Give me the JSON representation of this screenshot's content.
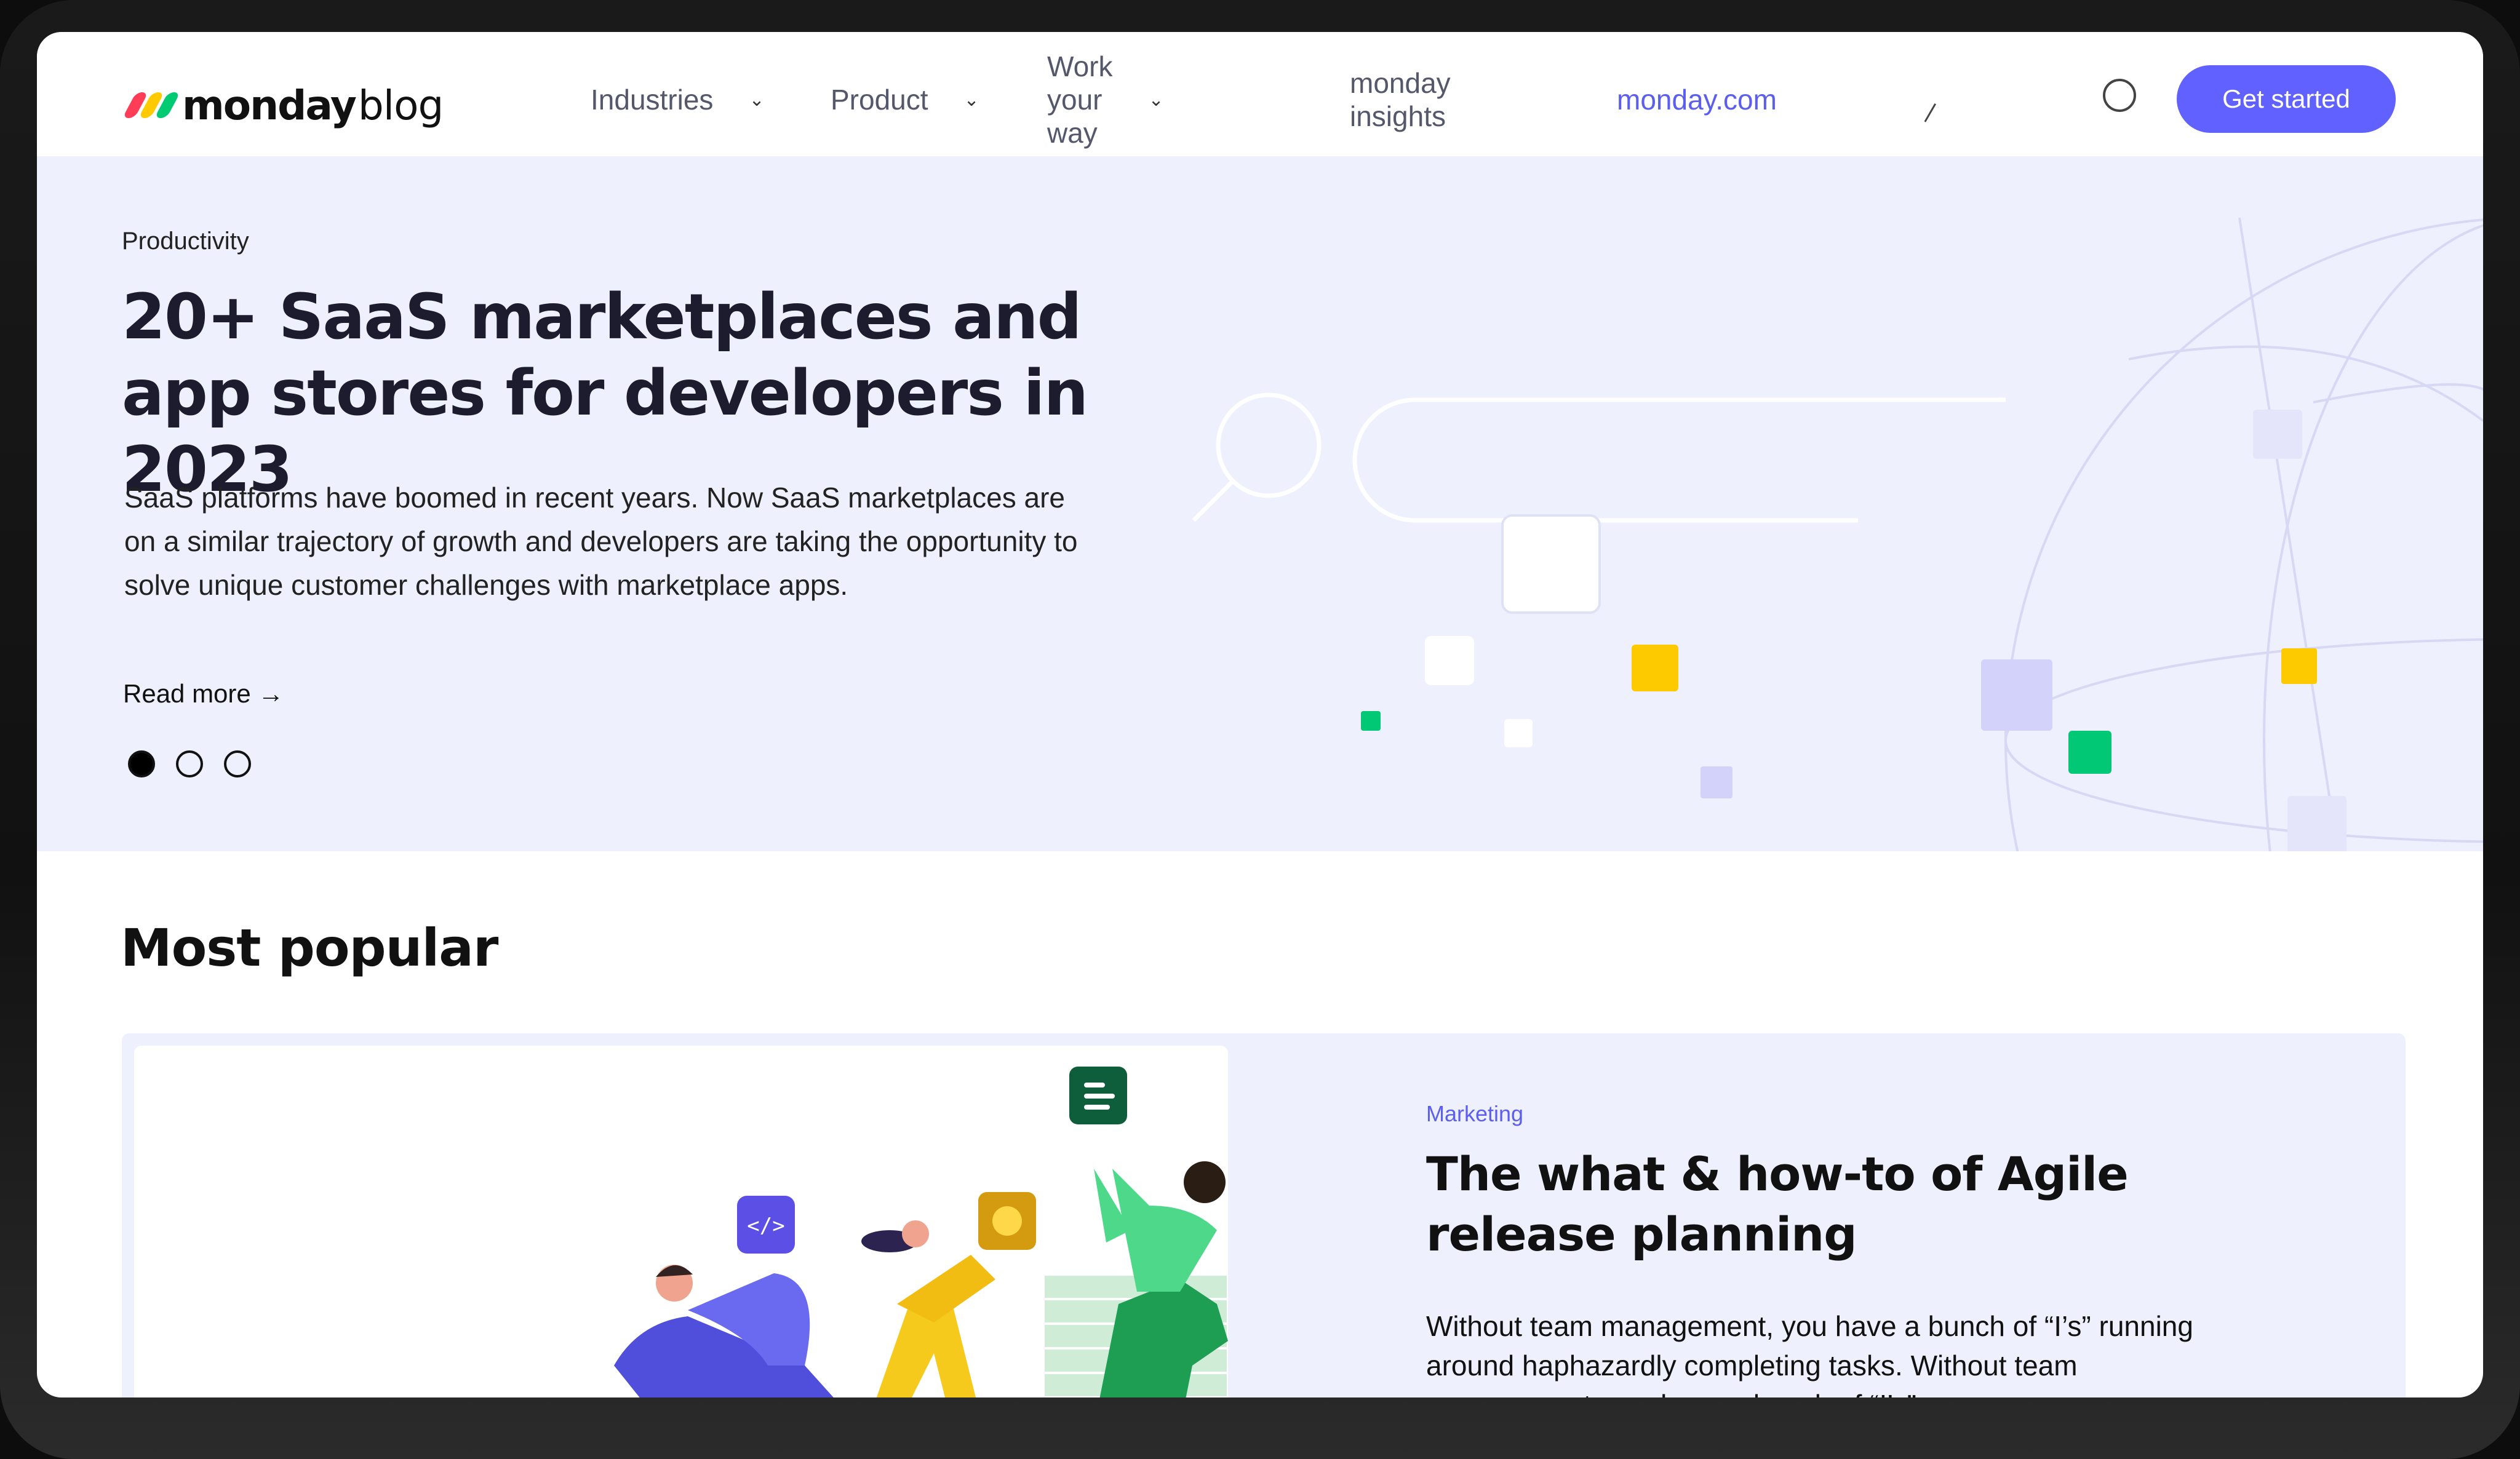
{
  "header": {
    "logo": {
      "wordmark": "monday",
      "suffix": "blog",
      "mark_colors": [
        "#ff3d57",
        "#ffcb00",
        "#00ca72"
      ]
    },
    "nav": [
      {
        "label": "Industries",
        "has_dropdown": true
      },
      {
        "label": "Product",
        "has_dropdown": true
      },
      {
        "label": "Work your way",
        "has_dropdown": true
      },
      {
        "label": "monday insights",
        "has_dropdown": false
      },
      {
        "label": "monday.com",
        "has_dropdown": false,
        "accent": true
      }
    ],
    "cta_label": "Get started",
    "chevron": "⌄"
  },
  "hero": {
    "kicker": "Productivity",
    "title": "20+ SaaS marketplaces and app stores for developers in 2023",
    "description": "SaaS platforms have boomed in recent years. Now SaaS marketplaces are on a similar trajectory of growth and developers are taking the opportunity to solve unique customer challenges with marketplace apps.",
    "read_more": "Read more →",
    "carousel": {
      "slides": 3,
      "active": 1
    }
  },
  "most_popular": {
    "heading": "Most popular",
    "card": {
      "kicker": "Marketing",
      "title": "The what & how-to of Agile release planning",
      "description": "Without team management, you have a bunch of “I’s” running around haphazardly completing tasks. Without team management, you have a bunch of “I’s”"
    }
  },
  "colors": {
    "accent": "#6161ff",
    "hero_bg": "#eef0fd",
    "green": "#00c875",
    "yellow": "#fdca00",
    "lavender": "#d3d2fb"
  }
}
